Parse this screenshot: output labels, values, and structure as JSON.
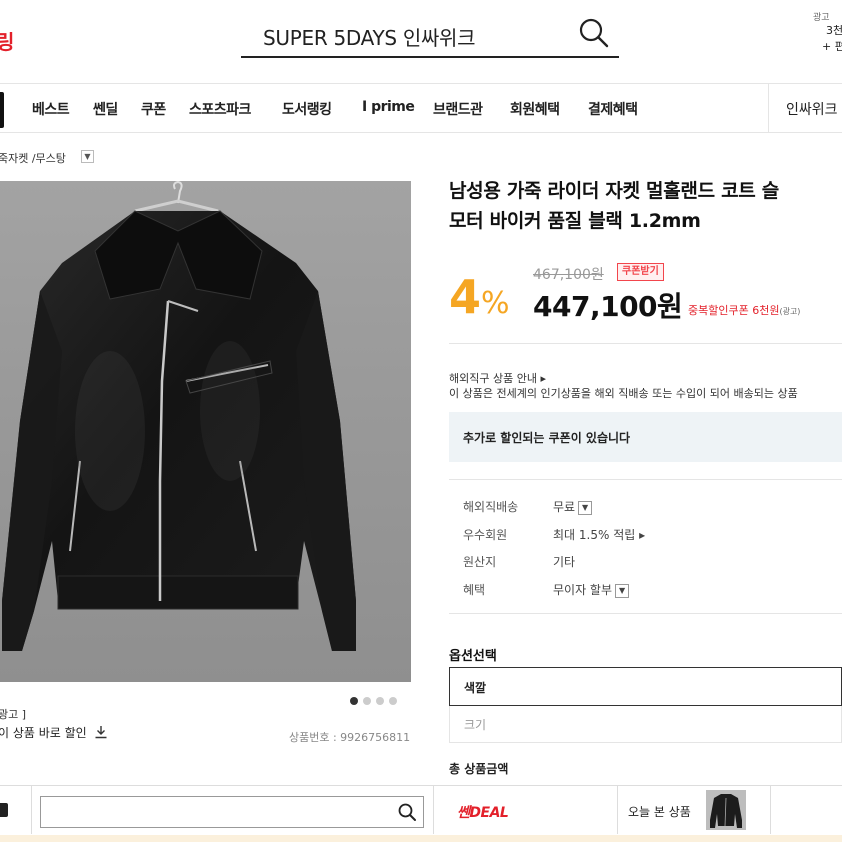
{
  "header": {
    "logo_fragment": "링",
    "search_value": "SUPER 5DAYS 인싸위크",
    "ad_tag": "광고",
    "ad_line1": "3천",
    "ad_line2": "+ 편"
  },
  "nav": {
    "items": [
      "베스트",
      "쎈딜",
      "쿠폰",
      "스포츠파크",
      "도서랭킹",
      "I prime",
      "브랜드관",
      "회원혜택",
      "결제혜택"
    ],
    "right": "인싸위크"
  },
  "breadcrumb": {
    "text": "죽자켓 /무스탕"
  },
  "gallery": {
    "active_index": 0,
    "count": 4,
    "ad_text": "광고 ]",
    "discount_link": "이 상품 바로 할인",
    "product_no": "상품번호 : 9926756811"
  },
  "product": {
    "title_line1": "남성용 가죽 라이더 자켓 멀홀랜드 코트 슬",
    "title_line2": "모터 바이커 품질 블랙 1.2mm",
    "discount_value": "4",
    "discount_pct": "%",
    "original_price": "467,100원",
    "coupon_button": "쿠폰받기",
    "price": "447,100원",
    "dup_coupon": "중복할인쿠폰 6천원",
    "dup_coupon_ad": "(광고)"
  },
  "overseas": {
    "label": "해외직구 상품 안내 ▸",
    "desc": "이 상품은 전세계의 인기상품을 해외 직배송 또는 수입이 되어 배송되는 상품"
  },
  "coupon_box": {
    "text": "추가로 할인되는 쿠폰이 있습니다"
  },
  "info": {
    "rows": [
      {
        "label": "해외직배송",
        "value": "무료"
      },
      {
        "label": "우수회원",
        "value": "최대 1.5% 적립 ▸"
      },
      {
        "label": "원산지",
        "value": "기타"
      },
      {
        "label": "혜택",
        "value": "무이자 할부"
      }
    ]
  },
  "options": {
    "title": "옵션선택",
    "color_label": "색깔",
    "size_label": "크기",
    "total_label": "총 상품금액"
  },
  "bottom_bar": {
    "deal_label": "쎈DEAL",
    "today_label": "오늘 본 상품"
  },
  "colors": {
    "brand_red": "#e3202a",
    "discount_orange": "#f5a623",
    "coupon_box_bg": "#eef3f6"
  }
}
